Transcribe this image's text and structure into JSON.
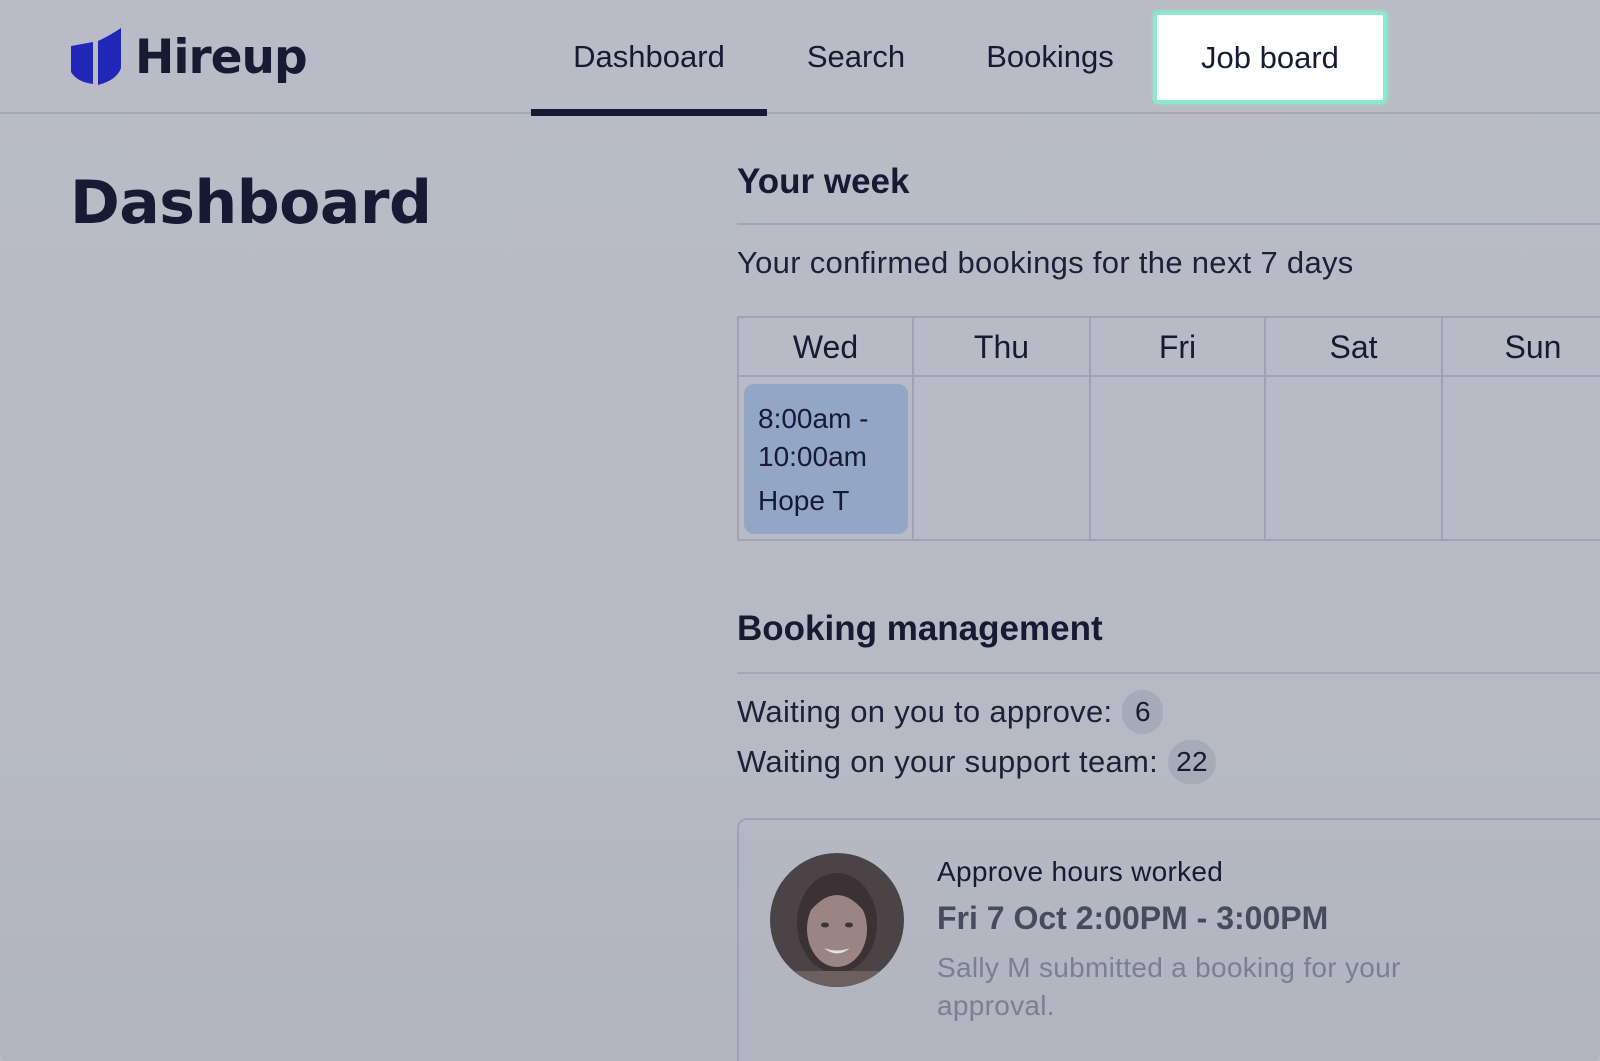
{
  "brand": {
    "name": "Hireup",
    "logo_icon": "hireup-shield-icon",
    "color": "#2127b8"
  },
  "nav": {
    "items": [
      {
        "label": "Dashboard",
        "state": "active"
      },
      {
        "label": "Search",
        "state": ""
      },
      {
        "label": "Bookings",
        "state": ""
      },
      {
        "label": "Job board",
        "state": "highlighted"
      }
    ]
  },
  "page": {
    "title": "Dashboard"
  },
  "week": {
    "heading": "Your week",
    "subtitle": "Your confirmed bookings for the next 7 days",
    "days": [
      "Wed",
      "Thu",
      "Fri",
      "Sat",
      "Sun"
    ],
    "bookings": [
      {
        "day": "Wed",
        "time_line1": "8:00am -",
        "time_line2": "10:00am",
        "name": "Hope T"
      }
    ]
  },
  "management": {
    "heading": "Booking management",
    "approve_label": "Waiting on you to approve:",
    "approve_count": "6",
    "support_label": "Waiting on your support team:",
    "support_count": "22",
    "card": {
      "kicker": "Approve hours worked",
      "title": "Fri 7 Oct 2:00PM - 3:00PM",
      "desc_line1": "Sally M submitted a booking for your",
      "desc_line2": "approval.",
      "avatar_icon": "user-avatar-icon"
    }
  },
  "colors": {
    "highlight": "#8de8cb",
    "booking_card": "#93a6c6",
    "overlay": "#b9bcc6"
  }
}
